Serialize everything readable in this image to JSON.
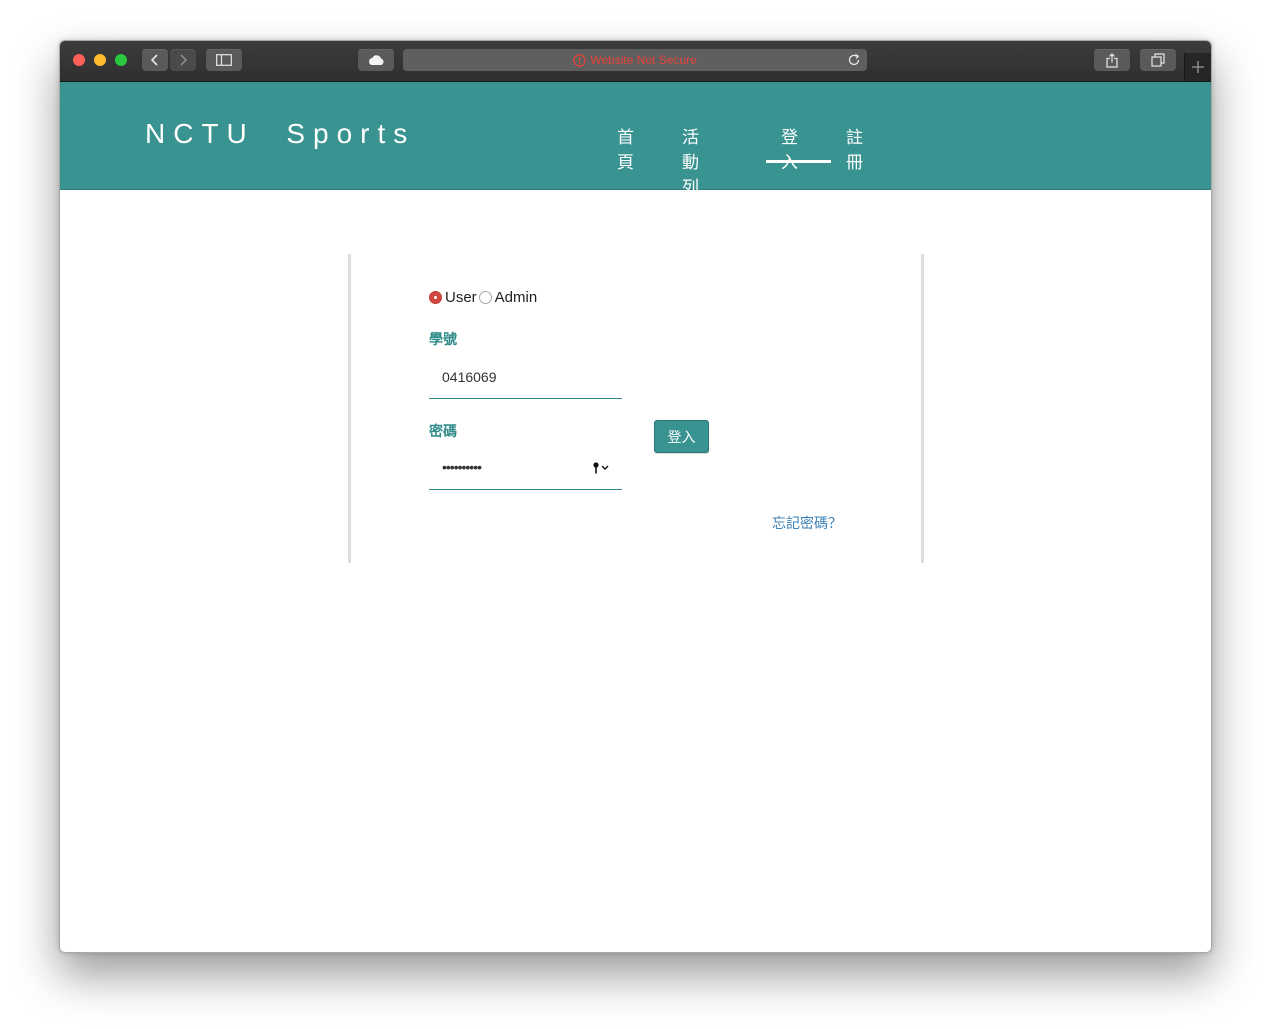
{
  "browser": {
    "address_text": "Website Not Secure",
    "warning_color": "#e8423a",
    "icons": [
      "back-icon",
      "forward-icon",
      "sidebar-icon",
      "cloud-icon",
      "warning-icon",
      "reload-icon",
      "share-icon",
      "tabs-icon",
      "plus-icon"
    ]
  },
  "site": {
    "brand": "NCTU  Sports",
    "accent_color": "#389391",
    "nav": [
      {
        "label": "首頁",
        "active": false
      },
      {
        "label": "活動列表",
        "active": false
      },
      {
        "label": "登入",
        "active": true
      },
      {
        "label": "註冊",
        "active": false
      }
    ]
  },
  "login_form": {
    "roles": [
      {
        "label": "User",
        "checked": true
      },
      {
        "label": "Admin",
        "checked": false
      }
    ],
    "student_id_label": "學號",
    "student_id_value": "0416069",
    "password_label": "密碼",
    "password_mask": "••••••••••",
    "submit_label": "登入",
    "forgot_label": "忘記密碼？"
  }
}
